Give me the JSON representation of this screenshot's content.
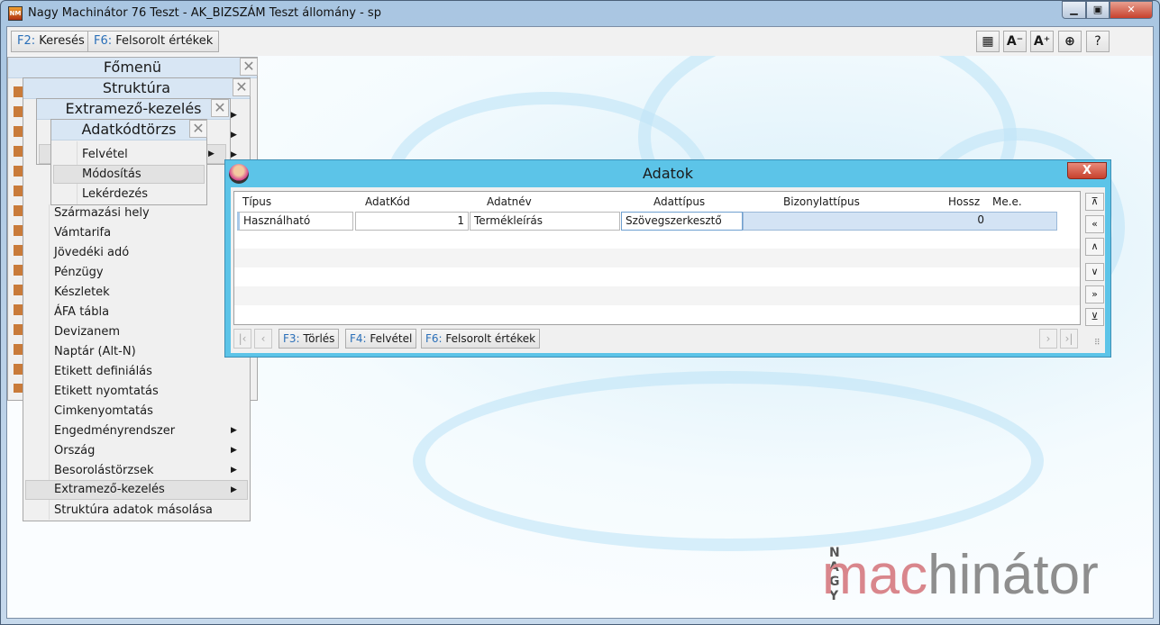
{
  "window": {
    "title": "Nagy Machinátor 76 Teszt - AK_BIZSZÁM Teszt állomány - sp",
    "app_icon": "NM"
  },
  "toolbar": {
    "buttons": [
      {
        "key": "F2:",
        "label": "Keresés"
      },
      {
        "key": "F6:",
        "label": "Felsorolt értékek"
      }
    ],
    "icons": [
      {
        "name": "grid-icon",
        "glyph": "▦"
      },
      {
        "name": "font-decrease-icon",
        "glyph": "A⁻"
      },
      {
        "name": "font-increase-icon",
        "glyph": "A⁺"
      },
      {
        "name": "lifebuoy-icon",
        "glyph": "⊕"
      },
      {
        "name": "help-icon",
        "glyph": "?"
      }
    ]
  },
  "menus": {
    "fomenu": {
      "title": "Főmenü"
    },
    "struktura": {
      "title": "Struktúra",
      "items": [
        "Származási hely",
        "Vámtarifa",
        "Jövedéki adó",
        "Pénzügy",
        "Készletek",
        "ÁFA tábla",
        "Devizanem",
        "Naptár (Alt-N)",
        "Etikett definiálás",
        "Etikett nyomtatás",
        "Cimkenyomtatás",
        "Engedményrendszer",
        "Ország",
        "Besorolástörzsek",
        "Extramező-kezelés",
        "Struktúra adatok másolása"
      ]
    },
    "extramezo": {
      "title": "Extramező-kezelés"
    },
    "adatkodtorzs": {
      "title": "Adatkódtörzs",
      "items": [
        "Felvétel",
        "Módosítás",
        "Lekérdezés"
      ]
    }
  },
  "dialog": {
    "title": "Adatok",
    "close": "X",
    "columns": [
      "Típus",
      "AdatKód",
      "Adatnév",
      "Adattípus",
      "Bizonylattípus",
      "Hossz",
      "Me.e."
    ],
    "rows": [
      {
        "tipus": "Használható",
        "adatkod": "1",
        "adatnev": "Termékleírás",
        "adattipus": "Szövegszerkesztő",
        "bizonylattipus": "",
        "hossz": "0",
        "mee": ""
      }
    ],
    "nav": [
      "⊼",
      "«",
      "∧",
      "∨",
      "»",
      "⊻"
    ],
    "footer": [
      {
        "key": "F3:",
        "label": "Törlés"
      },
      {
        "key": "F4:",
        "label": "Felvétel"
      },
      {
        "key": "F6:",
        "label": "Felsorolt értékek"
      }
    ]
  },
  "logo": {
    "top": "N A G Y",
    "part1": "mac",
    "part2": "hinátor"
  },
  "colors": {
    "dialog_title": "#5cc4e8",
    "key": "#2a6fb8",
    "logo_red": "#d9868c",
    "logo_grey": "#8e8e8e"
  }
}
